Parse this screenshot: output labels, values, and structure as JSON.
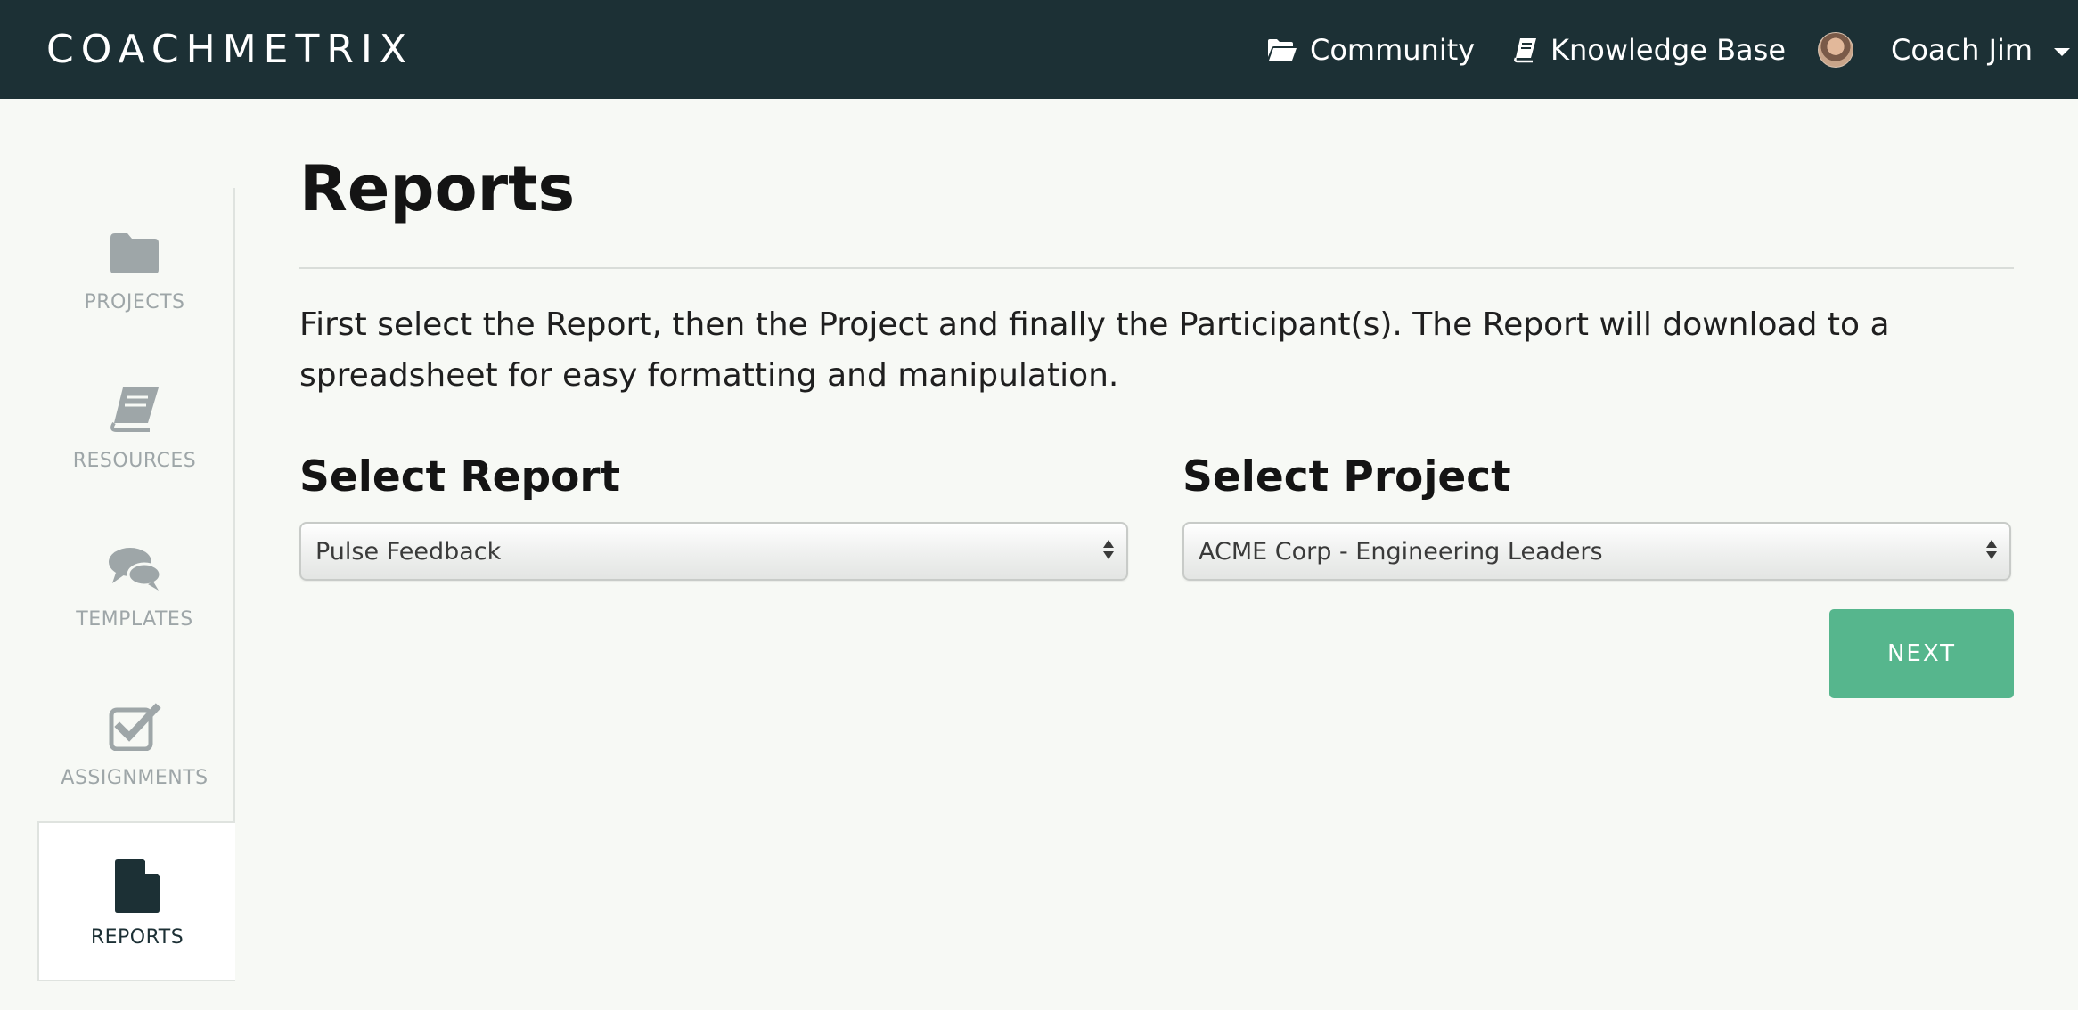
{
  "app": {
    "logo": "COACHMETRIX"
  },
  "topnav": {
    "community": "Community",
    "knowledge_base": "Knowledge Base",
    "user_name": "Coach Jim"
  },
  "sidebar": {
    "items": [
      {
        "label": "PROJECTS",
        "icon": "folder-icon"
      },
      {
        "label": "RESOURCES",
        "icon": "book-icon"
      },
      {
        "label": "TEMPLATES",
        "icon": "chat-bubbles-icon"
      },
      {
        "label": "ASSIGNMENTS",
        "icon": "checkbox-icon"
      },
      {
        "label": "REPORTS",
        "icon": "document-icon",
        "active": true
      }
    ]
  },
  "main": {
    "title": "Reports",
    "intro": "First select the Report, then the Project and finally the Participant(s). The Report will download to a spreadsheet for easy formatting and manipulation.",
    "select_report": {
      "label": "Select Report",
      "value": "Pulse Feedback"
    },
    "select_project": {
      "label": "Select Project",
      "value": "ACME Corp - Engineering Leaders"
    },
    "next_label": "NEXT"
  },
  "colors": {
    "topbar": "#1c3035",
    "background": "#f7f9f5",
    "accent": "#56b68d",
    "sidebar_muted": "#9ea6a8",
    "sidebar_active": "#1c3035"
  }
}
